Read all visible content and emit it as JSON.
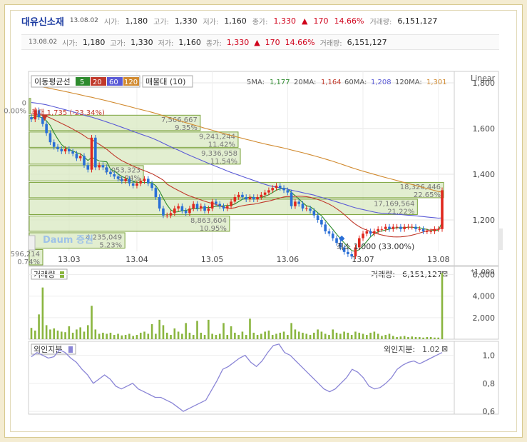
{
  "header": {
    "name": "대유신소재",
    "date": "13.08.02",
    "open_label": "시가:",
    "open": "1,180",
    "high_label": "고가:",
    "high": "1,330",
    "low_label": "저가:",
    "low": "1,160",
    "close_label": "종가:",
    "close": "1,330",
    "change_arrow": "▲",
    "change": "170",
    "change_pct": "14.66%",
    "volume_label": "거래량:",
    "volume": "6,151,127"
  },
  "price_panel": {
    "ma_label": "이동평균선",
    "ma_buttons": [
      "5",
      "20",
      "60",
      "120"
    ],
    "profile_label": "매물대 (10)",
    "ma_readout": [
      {
        "label": "5MA:",
        "value": "1,177"
      },
      {
        "label": "20MA:",
        "value": "1,164"
      },
      {
        "label": "60MA:",
        "value": "1,208"
      },
      {
        "label": "120MA:",
        "value": "1,301"
      }
    ],
    "scale_label": "Linear",
    "max_annotation": "최대 1,735 (-23.34%)",
    "min_annotation": "최소 1,000 (33.00%)",
    "watermark": "Daum 증권",
    "y_ticks": [
      "1,800",
      "1,600",
      "1,400",
      "1,200"
    ],
    "x_ticks": [
      "13.03",
      "13.04",
      "13.05",
      "13.06",
      "13.07",
      "13.08"
    ]
  },
  "volume_panel": {
    "title": "거래량",
    "readout_label": "거래량:",
    "readout_value": "6,151,127",
    "unit": "*1,000",
    "y_ticks": [
      "6,000",
      "4,000",
      "2,000"
    ]
  },
  "foreign_panel": {
    "title": "외인지분",
    "readout_label": "외인지분:",
    "readout_value": "1.02",
    "y_ticks": [
      "1,0",
      "0,8",
      "0,6"
    ]
  },
  "colors": {
    "ma5": "#2e8b2e",
    "ma20": "#c0392b",
    "ma60": "#5a5ad6",
    "ma120": "#d18a2f",
    "up_candle": "#e0281e",
    "down_candle": "#2a6fd6",
    "volume_bar": "#8ab53f",
    "profile_fill": "#d8e8c0",
    "profile_stroke": "#7aa23a",
    "foreign_line": "#8a85d6"
  },
  "chart_data": [
    {
      "type": "candlestick",
      "title": "대유신소재",
      "x_ticks": [
        "13.03",
        "13.04",
        "13.05",
        "13.06",
        "13.07",
        "13.08"
      ],
      "ylim": [
        1000,
        1850
      ],
      "close": [
        1640,
        1680,
        1650,
        1620,
        1580,
        1540,
        1520,
        1510,
        1500,
        1510,
        1500,
        1490,
        1470,
        1480,
        1440,
        1420,
        1560,
        1430,
        1440,
        1430,
        1410,
        1400,
        1390,
        1380,
        1370,
        1380,
        1360,
        1350,
        1360,
        1370,
        1380,
        1360,
        1340,
        1300,
        1250,
        1220,
        1220,
        1230,
        1250,
        1260,
        1240,
        1230,
        1250,
        1270,
        1250,
        1260,
        1240,
        1250,
        1280,
        1270,
        1260,
        1250,
        1260,
        1280,
        1300,
        1310,
        1300,
        1290,
        1300,
        1290,
        1300,
        1310,
        1320,
        1330,
        1340,
        1350,
        1340,
        1330,
        1320,
        1260,
        1280,
        1270,
        1250,
        1250,
        1240,
        1220,
        1200,
        1180,
        1150,
        1140,
        1120,
        1100,
        1080,
        1060,
        1050,
        1040,
        1080,
        1120,
        1140,
        1150,
        1140,
        1150,
        1160,
        1160,
        1170,
        1160,
        1170,
        1170,
        1160,
        1170,
        1170,
        1170,
        1160,
        1160,
        1150,
        1150,
        1150,
        1160,
        1160,
        1330
      ],
      "ma_lines": {
        "5MA": 1177,
        "20MA": 1164,
        "60MA": 1208,
        "120MA": 1301
      },
      "max": {
        "value": 1735,
        "label": "최대 1,735 (-23.34%)"
      },
      "min": {
        "value": 1000,
        "label": "최소 1,000 (33.00%)"
      },
      "volume_profile": [
        {
          "volume": "596,214",
          "pct": "0.74%"
        },
        {
          "volume": "4,235,049",
          "pct": "5.23%"
        },
        {
          "volume": "8,863,604",
          "pct": "10.95%"
        },
        {
          "volume": "17,169,564",
          "pct": "21.22%"
        },
        {
          "volume": "18,326,446",
          "pct": "22.65%"
        },
        {
          "volume": "5,053,323",
          "pct": "6.24%"
        },
        {
          "volume": "9,336,958",
          "pct": "11.54%"
        },
        {
          "volume": "9,241,244",
          "pct": "11.42%"
        },
        {
          "volume": "7,566,667",
          "pct": "9.35%"
        },
        {
          "volume": "0",
          "pct": "0.00%"
        }
      ]
    },
    {
      "type": "bar",
      "title": "거래량",
      "ylim": [
        0,
        6500
      ],
      "y_ticks": [
        2000,
        4000,
        6000
      ],
      "values": [
        1050,
        800,
        2300,
        4800,
        1300,
        900,
        1000,
        800,
        700,
        650,
        1200,
        600,
        900,
        1100,
        700,
        1300,
        3100,
        900,
        500,
        600,
        500,
        600,
        400,
        500,
        350,
        400,
        500,
        300,
        400,
        600,
        700,
        500,
        1400,
        500,
        1800,
        1300,
        600,
        400,
        1000,
        700,
        500,
        1500,
        600,
        400,
        1700,
        600,
        400,
        1800,
        500,
        400,
        500,
        1500,
        400,
        1200,
        600,
        400,
        700,
        400,
        1900,
        600,
        400,
        500,
        700,
        800,
        400,
        500,
        600,
        700,
        400,
        1500,
        900,
        700,
        600,
        500,
        400,
        600,
        900,
        700,
        500,
        400,
        900,
        600,
        500,
        700,
        600,
        400,
        700,
        600,
        500,
        400,
        600,
        700,
        500,
        300,
        400,
        500,
        300,
        200,
        250,
        300,
        200,
        250,
        200,
        200,
        150,
        200,
        200,
        150,
        150,
        6151
      ]
    },
    {
      "type": "line",
      "title": "외인지분",
      "ylim": [
        0.58,
        1.1
      ],
      "y_ticks": [
        1.0,
        0.8,
        0.6
      ],
      "values": [
        0.99,
        1.02,
        1.0,
        0.98,
        0.99,
        1.04,
        1.02,
        0.98,
        0.95,
        0.9,
        0.86,
        0.8,
        0.83,
        0.86,
        0.83,
        0.78,
        0.76,
        0.78,
        0.8,
        0.76,
        0.74,
        0.72,
        0.7,
        0.7,
        0.68,
        0.66,
        0.63,
        0.6,
        0.62,
        0.64,
        0.66,
        0.68,
        0.75,
        0.82,
        0.9,
        0.92,
        0.95,
        0.98,
        1.0,
        0.95,
        0.92,
        0.96,
        1.02,
        1.07,
        1.08,
        1.02,
        1.0,
        0.96,
        0.92,
        0.88,
        0.84,
        0.8,
        0.76,
        0.74,
        0.76,
        0.8,
        0.84,
        0.9,
        0.88,
        0.84,
        0.78,
        0.76,
        0.77,
        0.8,
        0.84,
        0.9,
        0.93,
        0.95,
        0.96,
        0.94,
        0.96,
        0.98,
        1.0,
        1.02
      ]
    }
  ]
}
